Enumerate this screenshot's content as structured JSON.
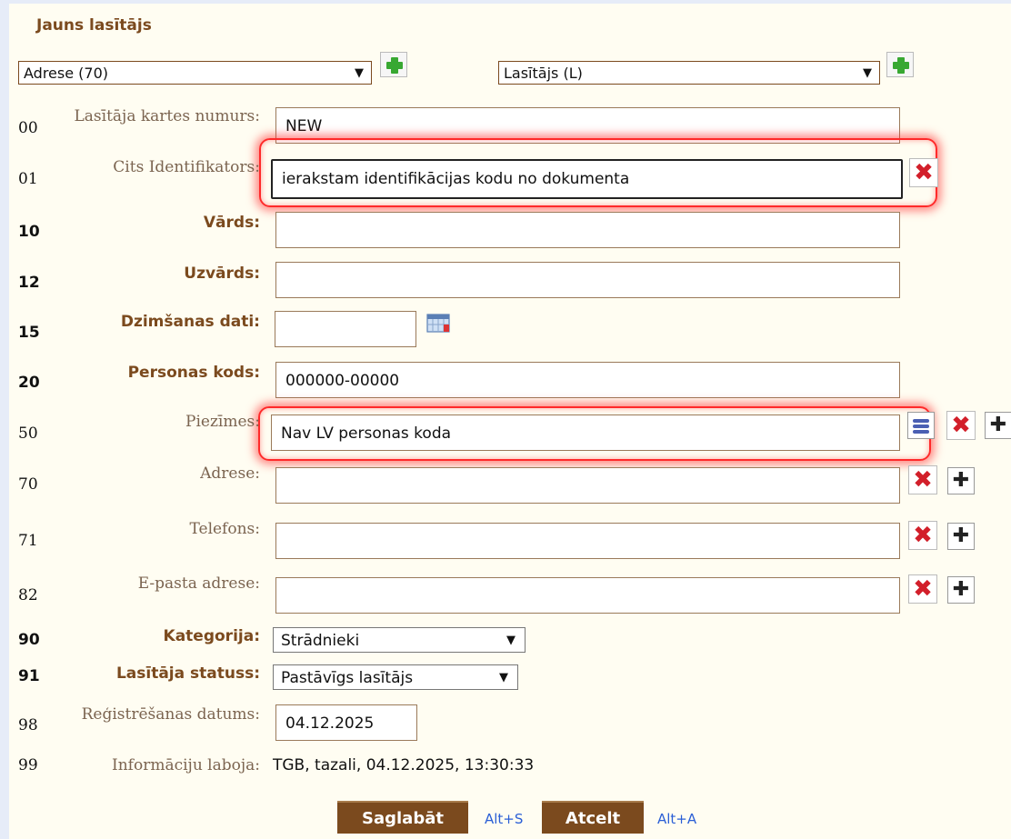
{
  "form": {
    "title": "Jauns lasītājs"
  },
  "selectors": {
    "left": "Adrese (70)",
    "right": "Lasītājs (L)"
  },
  "fields": [
    {
      "num": "00",
      "label": "Lasītāja kartes numurs:",
      "value": ""
    },
    {
      "num": "01",
      "label": "Cits Identifikators:",
      "value": "ierakstam identifikācijas kodu no dokumenta"
    },
    {
      "num": "10",
      "label": "Vārds:",
      "value": ""
    },
    {
      "num": "12",
      "label": "Uzvārds:",
      "value": ""
    },
    {
      "num": "15",
      "label": "Dzimšanas dati:",
      "value": ""
    },
    {
      "num": "20",
      "label": "Personas kods:",
      "value": "000000-00000"
    },
    {
      "num": "50",
      "label": "Piezīmes:",
      "value": "Nav LV personas koda"
    },
    {
      "num": "70",
      "label": "Adrese:",
      "value": ""
    },
    {
      "num": "71",
      "label": "Telefons:",
      "value": ""
    },
    {
      "num": "82",
      "label": "E-pasta adrese:",
      "value": ""
    },
    {
      "num": "90",
      "label": "Kategorija:",
      "value": "Strādnieki"
    },
    {
      "num": "91",
      "label": "Lasītāja statuss:",
      "value": "Pastāvīgs lasītājs"
    },
    {
      "num": "98",
      "label": "Reģistrēšanas datums:",
      "value": "04.12.2025"
    },
    {
      "num": "99",
      "label": "Informāciju laboja:",
      "value": "TGB, tazali, 04.12.2025, 13:30:33"
    }
  ],
  "card_value": "NEW",
  "buttons": {
    "save": "Saglabāt",
    "save_hotkey": "Alt+S",
    "cancel": "Atcelt",
    "cancel_hotkey": "Alt+A"
  },
  "icons": {
    "add": "green-plus-icon",
    "delete": "red-x-icon",
    "list": "list-icon",
    "calendar": "calendar-icon",
    "dropdown": "chevron-down-icon"
  },
  "colors": {
    "label_bold": "#7b4a1e",
    "label_normal": "#7b6450",
    "button_bg": "#7b4a1e",
    "highlight": "#ff2a2a",
    "hotkey": "#2b5fd6"
  }
}
